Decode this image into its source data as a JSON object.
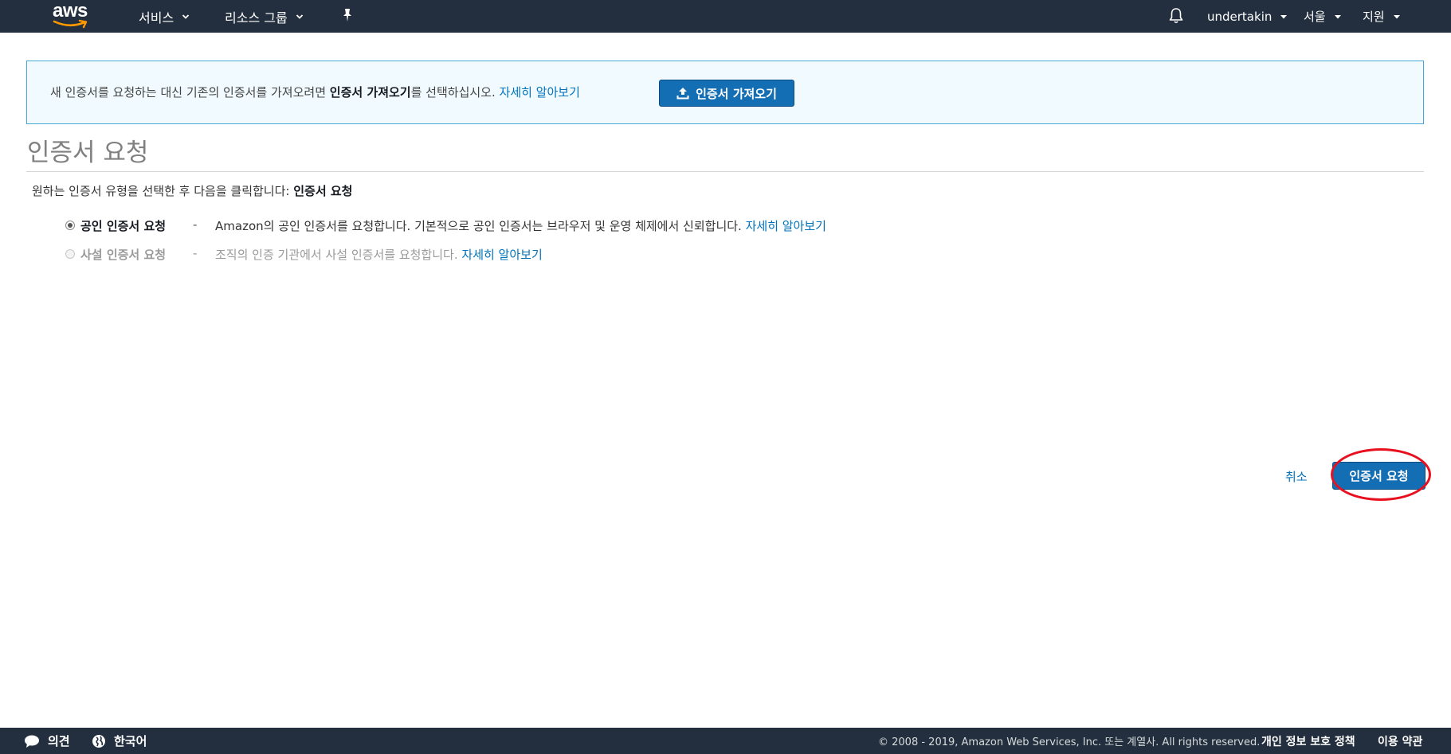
{
  "nav": {
    "logo": "aws",
    "services": "서비스",
    "resource_groups": "리소스 그룹",
    "account": "undertakin",
    "region": "서울",
    "support": "지원"
  },
  "banner": {
    "text_before": "새 인증서를 요청하는 대신 기존의 인증서를 가져오려면 ",
    "text_bold": "인증서 가져오기",
    "text_after": "를 선택하십시오. ",
    "learn_more": "자세히 알아보기",
    "import_button": "인증서 가져오기"
  },
  "page": {
    "title": "인증서 요청",
    "instruction_text": "원하는 인증서 유형을 선택한 후 다음을 클릭합니다: ",
    "instruction_bold": "인증서 요청"
  },
  "options": [
    {
      "label": "공인 인증서 요청",
      "dash": "-",
      "description": "Amazon의 공인 인증서를 요청합니다. 기본적으로 공인 인증서는 브라우저 및 운영 체제에서 신뢰합니다. ",
      "learn_more": "자세히 알아보기",
      "selected": true,
      "enabled": true
    },
    {
      "label": "사설 인증서 요청",
      "dash": "-",
      "description": "조직의 인증 기관에서 사설 인증서를 요청합니다. ",
      "learn_more": "자세히 알아보기",
      "selected": false,
      "enabled": false
    }
  ],
  "actions": {
    "cancel": "취소",
    "request": "인증서 요청"
  },
  "footer": {
    "feedback": "의견",
    "language": "한국어",
    "copyright": "© 2008 - 2019, Amazon Web Services, Inc. 또는 계열사. All rights reserved.",
    "privacy": "개인 정보 보호 정책",
    "terms": "이용 약관"
  },
  "colors": {
    "nav_bg": "#232f3e",
    "primary_button": "#146eb4",
    "link": "#0073bb",
    "banner_bg": "#f1faff",
    "banner_border": "#45a8d9",
    "highlight_ring": "#e8101e"
  },
  "icons": {
    "pin": "pin-icon",
    "bell": "bell-icon",
    "upload": "upload-icon",
    "feedback": "speech-bubble-icon",
    "language": "globe-icon"
  }
}
